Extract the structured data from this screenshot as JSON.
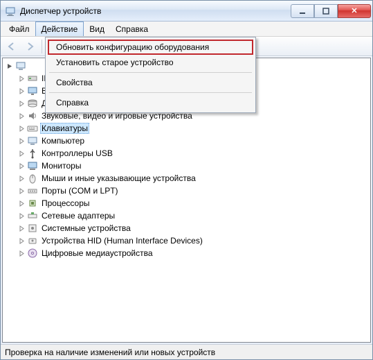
{
  "window": {
    "title": "Диспетчер устройств"
  },
  "menubar": {
    "items": [
      {
        "label": "Файл"
      },
      {
        "label": "Действие"
      },
      {
        "label": "Вид"
      },
      {
        "label": "Справка"
      }
    ]
  },
  "dropdown": {
    "items": [
      {
        "label": "Обновить конфигурацию оборудования",
        "highlight": true
      },
      {
        "label": "Установить старое устройство"
      },
      {
        "sep": true
      },
      {
        "label": "Свойства"
      },
      {
        "sep": true
      },
      {
        "label": "Справка"
      }
    ]
  },
  "tree": {
    "root_icon": "computer",
    "items": [
      {
        "label": "IDE ATA/ATAPI контроллеры",
        "icon": "ide"
      },
      {
        "label": "Видеоадаптеры",
        "icon": "display"
      },
      {
        "label": "Дисковые устройства",
        "icon": "disk"
      },
      {
        "label": "Звуковые, видео и игровые устройства",
        "icon": "sound"
      },
      {
        "label": "Клавиатуры",
        "icon": "keyboard",
        "selected": true
      },
      {
        "label": "Компьютер",
        "icon": "computer"
      },
      {
        "label": "Контроллеры USB",
        "icon": "usb"
      },
      {
        "label": "Мониторы",
        "icon": "monitor"
      },
      {
        "label": "Мыши и иные указывающие устройства",
        "icon": "mouse"
      },
      {
        "label": "Порты (COM и LPT)",
        "icon": "port"
      },
      {
        "label": "Процессоры",
        "icon": "cpu"
      },
      {
        "label": "Сетевые адаптеры",
        "icon": "network"
      },
      {
        "label": "Системные устройства",
        "icon": "system"
      },
      {
        "label": "Устройства HID (Human Interface Devices)",
        "icon": "hid"
      },
      {
        "label": "Цифровые медиаустройства",
        "icon": "media"
      }
    ]
  },
  "statusbar": {
    "text": "Проверка на наличие изменений или новых устройств"
  }
}
